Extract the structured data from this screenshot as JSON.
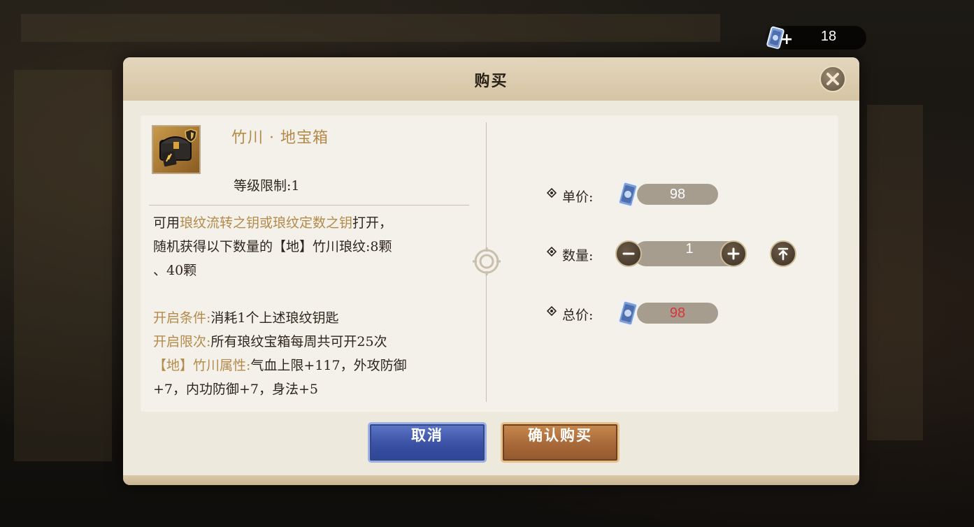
{
  "currency": {
    "amount": "18",
    "plus_icon": "plus-icon"
  },
  "dialog": {
    "title": "购买",
    "item": {
      "name": "竹川 · 地宝箱",
      "level_label": "等级限制:",
      "level_value": "1"
    },
    "description": {
      "line1_prefix": "可用",
      "line1_highlight": "琅纹流转之钥或琅纹定数之钥",
      "line1_suffix": "打开，",
      "line2": "随机获得以下数量的【地】竹川琅纹:8颗",
      "line3": "、40颗",
      "cond_label": "开启条件:",
      "cond_value": "消耗1个上述琅纹钥匙",
      "limit_label": "开启限次:",
      "limit_value": "所有琅纹宝箱每周共可开25次",
      "attr_label": "【地】竹川属性:",
      "attr_value": "气血上限+117，外攻防御",
      "attr_value2": "+7，内功防御+7，身法+5"
    },
    "unit_price": {
      "label": "单价:",
      "value": "98"
    },
    "quantity": {
      "label": "数量:",
      "value": "1"
    },
    "total_price": {
      "label": "总价:",
      "value": "98"
    },
    "buttons": {
      "cancel": "取消",
      "confirm": "确认购买"
    }
  },
  "colors": {
    "highlight": "#b48a4a",
    "total_price": "#d9353a",
    "cancel_button": "#3a51a4",
    "confirm_button": "#a8693a"
  }
}
